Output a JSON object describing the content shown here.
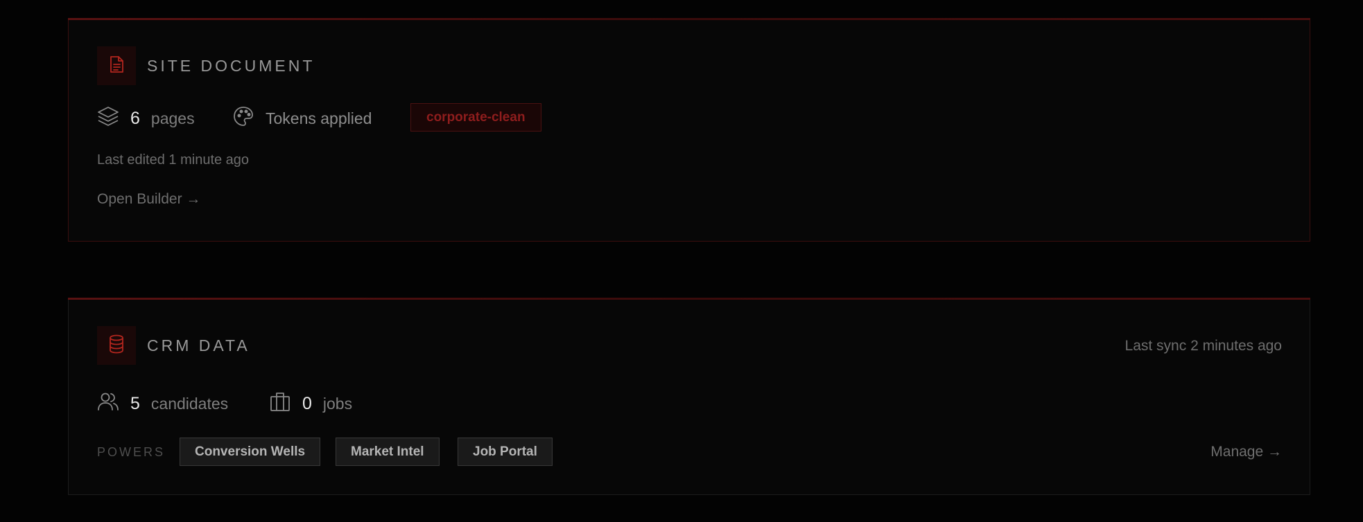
{
  "site_document": {
    "title": "SITE DOCUMENT",
    "icon": "document-icon",
    "pages_count": "6",
    "pages_label": "pages",
    "tokens_label": "Tokens applied",
    "theme_badge": "corporate-clean",
    "last_edited": "Last edited 1 minute ago",
    "open_builder": "Open Builder →"
  },
  "crm_data": {
    "title": "CRM DATA",
    "icon": "database-icon",
    "last_sync": "Last sync 2 minutes ago",
    "candidates_count": "5",
    "candidates_label": "candidates",
    "jobs_count": "0",
    "jobs_label": "jobs",
    "powers_label": "POWERS",
    "powers": [
      "Conversion Wells",
      "Market Intel",
      "Job Portal"
    ],
    "manage": "Manage →"
  },
  "colors": {
    "accent_red": "#b3261e",
    "background": "#030303",
    "card_bg": "#070707"
  }
}
